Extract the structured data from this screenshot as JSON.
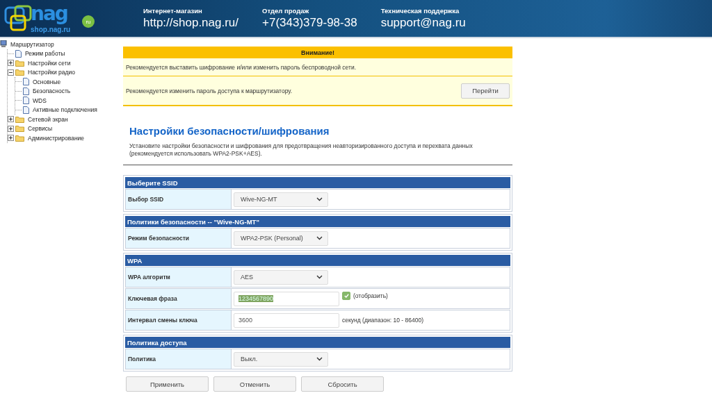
{
  "header": {
    "logo": {
      "brand": "nag",
      "site": "shop.nag.ru",
      "badge": "ru"
    },
    "contacts": [
      {
        "label": "Интернет-магазин",
        "value": "http://shop.nag.ru/"
      },
      {
        "label": "Отдел продаж",
        "value": "+7(343)379-98-38"
      },
      {
        "label": "Техническая поддержка",
        "value": "support@nag.ru"
      }
    ]
  },
  "tree": {
    "label": "Маршрутизатор",
    "kind": "root",
    "children": [
      {
        "label": "Режим работы",
        "kind": "page"
      },
      {
        "label": "Настройки сети",
        "kind": "folder",
        "expanded": false
      },
      {
        "label": "Настройки радио",
        "kind": "folder",
        "expanded": true,
        "children": [
          {
            "label": "Основные",
            "kind": "page"
          },
          {
            "label": "Безопасность",
            "kind": "page"
          },
          {
            "label": "WDS",
            "kind": "page"
          },
          {
            "label": "Активные подключения",
            "kind": "page"
          }
        ]
      },
      {
        "label": "Сетевой экран",
        "kind": "folder",
        "expanded": false
      },
      {
        "label": "Сервисы",
        "kind": "folder",
        "expanded": false
      },
      {
        "label": "Администрирование",
        "kind": "folder",
        "expanded": false
      }
    ]
  },
  "alert": {
    "title": "Внимание!",
    "messages": [
      {
        "text": "Рекомендуется выставить шифрование и/или изменить пароль беспроводной сети."
      },
      {
        "text": "Рекомендуется изменить пароль доступа к маршрутизатору.",
        "button": "Перейти"
      }
    ]
  },
  "page_title": "Настройки безопасности/шифрования",
  "description": "Установите настройки безопасности и шифрования для предотвращения неавторизированного доступа и перехвата данных (рекомендуется использовать WPA2-PSK+AES).",
  "sections": [
    {
      "title": "Выберите SSID",
      "rows": [
        {
          "label": "Выбор SSID",
          "kind": "select",
          "value": "Wive-NG-MT"
        }
      ]
    },
    {
      "title": "Политики безопасности -- \"Wive-NG-MT\"",
      "rows": [
        {
          "label": "Режим безопасности",
          "kind": "select",
          "value": "WPA2-PSK (Personal)"
        }
      ]
    },
    {
      "title": "WPA",
      "rows": [
        {
          "label": "WPA алгоритм",
          "kind": "select",
          "value": "AES"
        },
        {
          "label": "Ключевая фраза",
          "kind": "input",
          "value": "1234567890",
          "text_selected": true,
          "checkbox": {
            "label": "(отобразить)",
            "checked": true
          }
        },
        {
          "label": "Интервал смены ключа",
          "kind": "input",
          "value": "3600",
          "text_selected": false,
          "note": "секунд (диапазон: 10 - 86400)"
        }
      ]
    },
    {
      "title": "Политика доступа",
      "rows": [
        {
          "label": "Политика",
          "kind": "select",
          "value": "Выкл."
        }
      ]
    }
  ],
  "buttons": [
    "Применить",
    "Отменить",
    "Сбросить"
  ]
}
